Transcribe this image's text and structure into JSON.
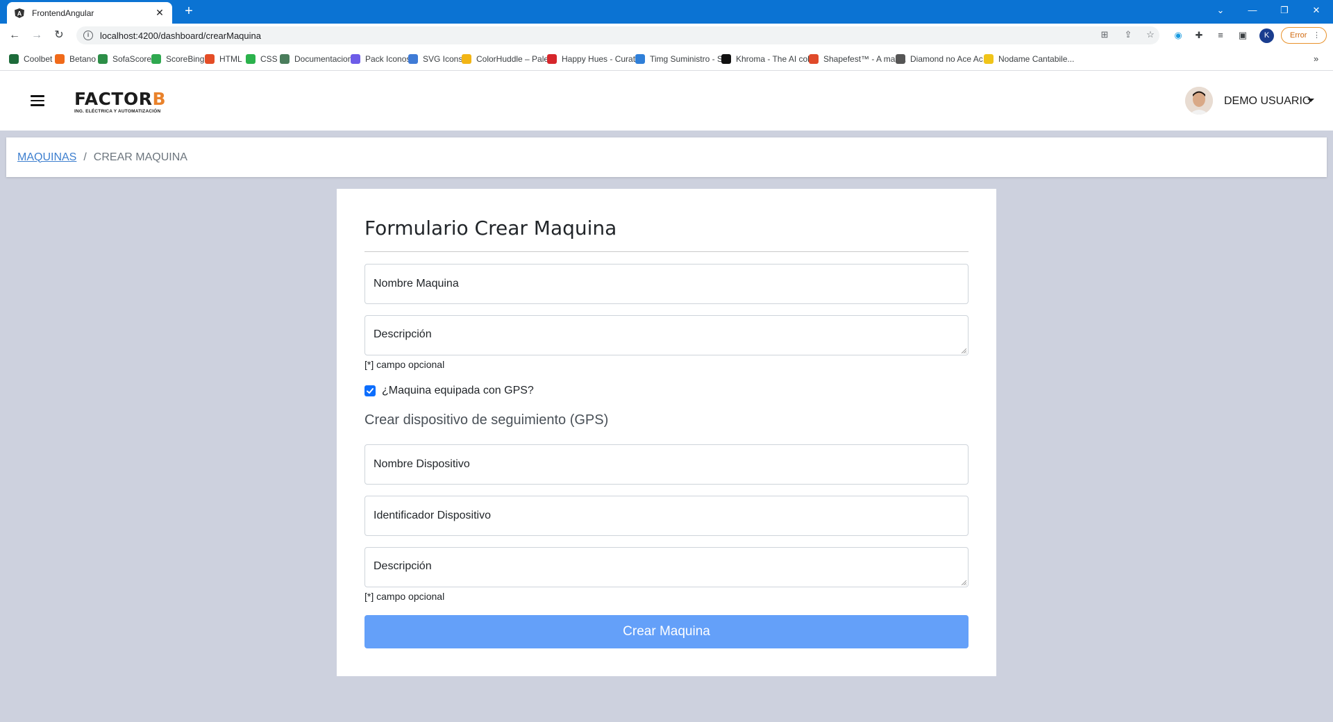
{
  "browser": {
    "tab_title": "FrontendAngular",
    "url": "localhost:4200/dashboard/crearMaquina",
    "profile_initial": "K",
    "error_label": "Error",
    "bookmarks": [
      {
        "label": "Coolbet",
        "color": "#1d6b3a"
      },
      {
        "label": "Betano",
        "color": "#f06a1a"
      },
      {
        "label": "SofaScore",
        "color": "#2c8e47"
      },
      {
        "label": "ScoreBing",
        "color": "#2fa84f"
      },
      {
        "label": "HTML",
        "color": "#e44d26"
      },
      {
        "label": "CSS",
        "color": "#2bb24c"
      },
      {
        "label": "Documentacion",
        "color": "#4a7d5c"
      },
      {
        "label": "Pack Iconos",
        "color": "#6d5ce8"
      },
      {
        "label": "SVG Icons",
        "color": "#3f7bd6"
      },
      {
        "label": "ColorHuddle – Pale...",
        "color": "#f2b515"
      },
      {
        "label": "Happy Hues - Curat...",
        "color": "#d6262b"
      },
      {
        "label": "Timg Suministro - S...",
        "color": "#2f7fd8"
      },
      {
        "label": "Khroma - The AI col...",
        "color": "#111111"
      },
      {
        "label": "Shapefest™ - A mas...",
        "color": "#e04a2a"
      },
      {
        "label": "Diamond no Ace Ac...",
        "color": "#555555"
      },
      {
        "label": "Nodame Cantabile...",
        "color": "#f0c419"
      }
    ]
  },
  "header": {
    "logo_text_main": "FACTOR",
    "logo_text_accent": "B",
    "logo_subtitle": "ING. ELÉCTRICA Y AUTOMATIZACIÓN",
    "user_name": "DEMO USUARIO"
  },
  "breadcrumb": {
    "parent": "MAQUINAS",
    "separator": "/",
    "current": "CREAR MAQUINA"
  },
  "form": {
    "title": "Formulario Crear Maquina",
    "nombre_maquina_placeholder": "Nombre Maquina",
    "descripcion_placeholder": "Descripción",
    "optional_hint": "[*] campo opcional",
    "gps_checkbox_label": "¿Maquina equipada con GPS?",
    "gps_checked": true,
    "gps_section_title": "Crear dispositivo de seguimiento (GPS)",
    "nombre_dispositivo_placeholder": "Nombre Dispositivo",
    "identificador_dispositivo_placeholder": "Identificador Dispositivo",
    "descripcion_dispositivo_placeholder": "Descripción",
    "optional_hint_2": "[*] campo opcional",
    "submit_label": "Crear Maquina"
  },
  "colors": {
    "chrome_blue": "#0b73d3",
    "page_bg": "#cdd1de",
    "primary": "#0d6efd",
    "submit_bg": "#64a0f9",
    "logo_accent": "#e9822b"
  }
}
